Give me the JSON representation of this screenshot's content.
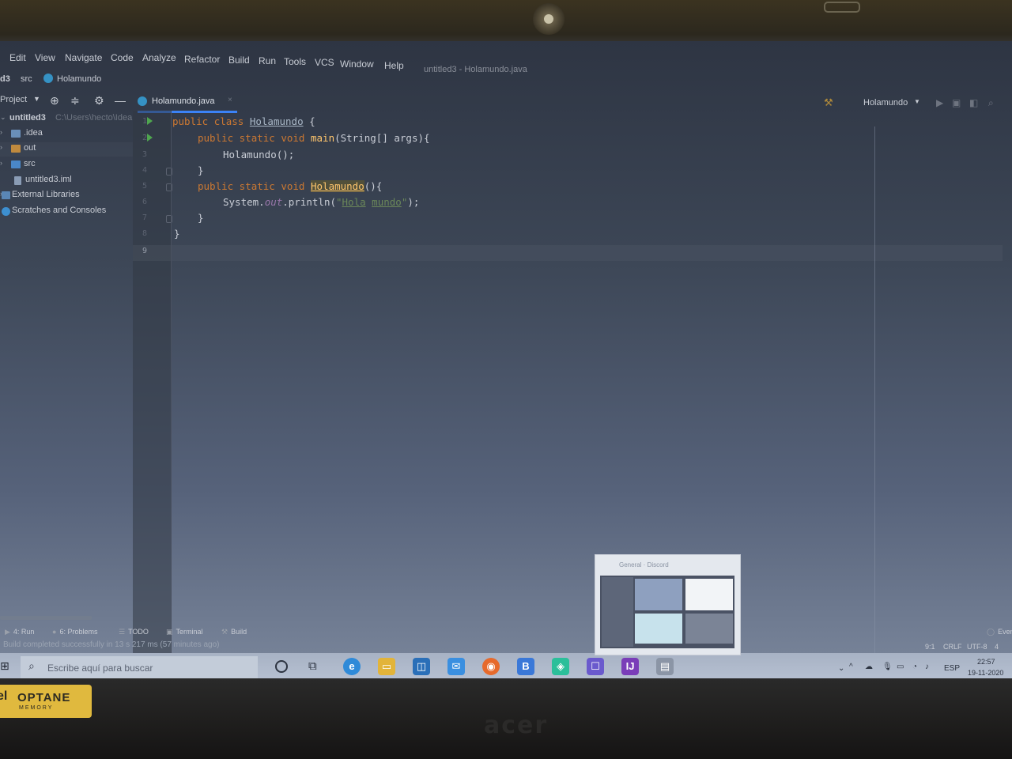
{
  "menu": {
    "edit": "Edit",
    "view": "View",
    "navigate": "Navigate",
    "code": "Code",
    "analyze": "Analyze",
    "refactor": "Refactor",
    "build": "Build",
    "run": "Run",
    "tools": "Tools",
    "vcs": "VCS",
    "window": "Window",
    "help": "Help"
  },
  "window_title": "untitled3 - Holamundo.java",
  "breadcrumb": {
    "project": "d3",
    "src": "src",
    "class": "Holamundo"
  },
  "project_panel": {
    "title": "Project",
    "tree": [
      {
        "label": "untitled3",
        "hint": "C:\\Users\\hecto\\Idea",
        "bold": true
      },
      {
        "label": ".idea"
      },
      {
        "label": "out"
      },
      {
        "label": "src"
      },
      {
        "label": "untitled3.iml"
      },
      {
        "label": "External Libraries"
      },
      {
        "label": "Scratches and Consoles"
      }
    ]
  },
  "editor": {
    "tab_label": "Holamundo.java",
    "line_numbers": [
      "1",
      "2",
      "3",
      "4",
      "5",
      "6",
      "7",
      "8",
      "9"
    ],
    "current_line": "9",
    "code": {
      "l1_public": "public",
      "l1_class": "class",
      "l1_name": "Holamundo",
      "l1_brace": " {",
      "l2_kw": "public static void",
      "l2_main": "main",
      "l2_rest": "(String[] args){",
      "l3_call": "Holamundo();",
      "l4": "}",
      "l5_kw": "public static void",
      "l5_name": "Holamundo",
      "l5_rest": "(){",
      "l6_sys": "System.",
      "l6_out": "out",
      "l6_println": ".println(",
      "l6_q1": "\"",
      "l6_w1": "Hola",
      "l6_sp": " ",
      "l6_w2": "mundo",
      "l6_q2": "\"",
      "l6_end": ");",
      "l7": "}",
      "l8": "}"
    }
  },
  "run_config": {
    "name": "Holamundo"
  },
  "bottom_tools": {
    "run": "4: Run",
    "problems": "6: Problems",
    "todo": "TODO",
    "terminal": "Terminal",
    "build": "Build",
    "event_log": "Even"
  },
  "status": {
    "message": "Build completed successfully in 13 s 217 ms (57 minutes ago)",
    "position": "9:1",
    "line_sep": "CRLF",
    "encoding": "UTF-8",
    "indent": "4 spa"
  },
  "taskbar": {
    "search_placeholder": "Escribe aquí para buscar",
    "lang": "ESP",
    "time": "22:57",
    "date": "19-11-2020",
    "thumb_title": "General · Discord"
  },
  "sticker": {
    "brand": "el",
    "main": "OPTANE",
    "sub": "MEMORY"
  },
  "colors": {
    "accent": "#3b82f6",
    "keyword": "#cc7832",
    "function": "#ffc66d",
    "string": "#6a8759",
    "field": "#9876aa"
  }
}
